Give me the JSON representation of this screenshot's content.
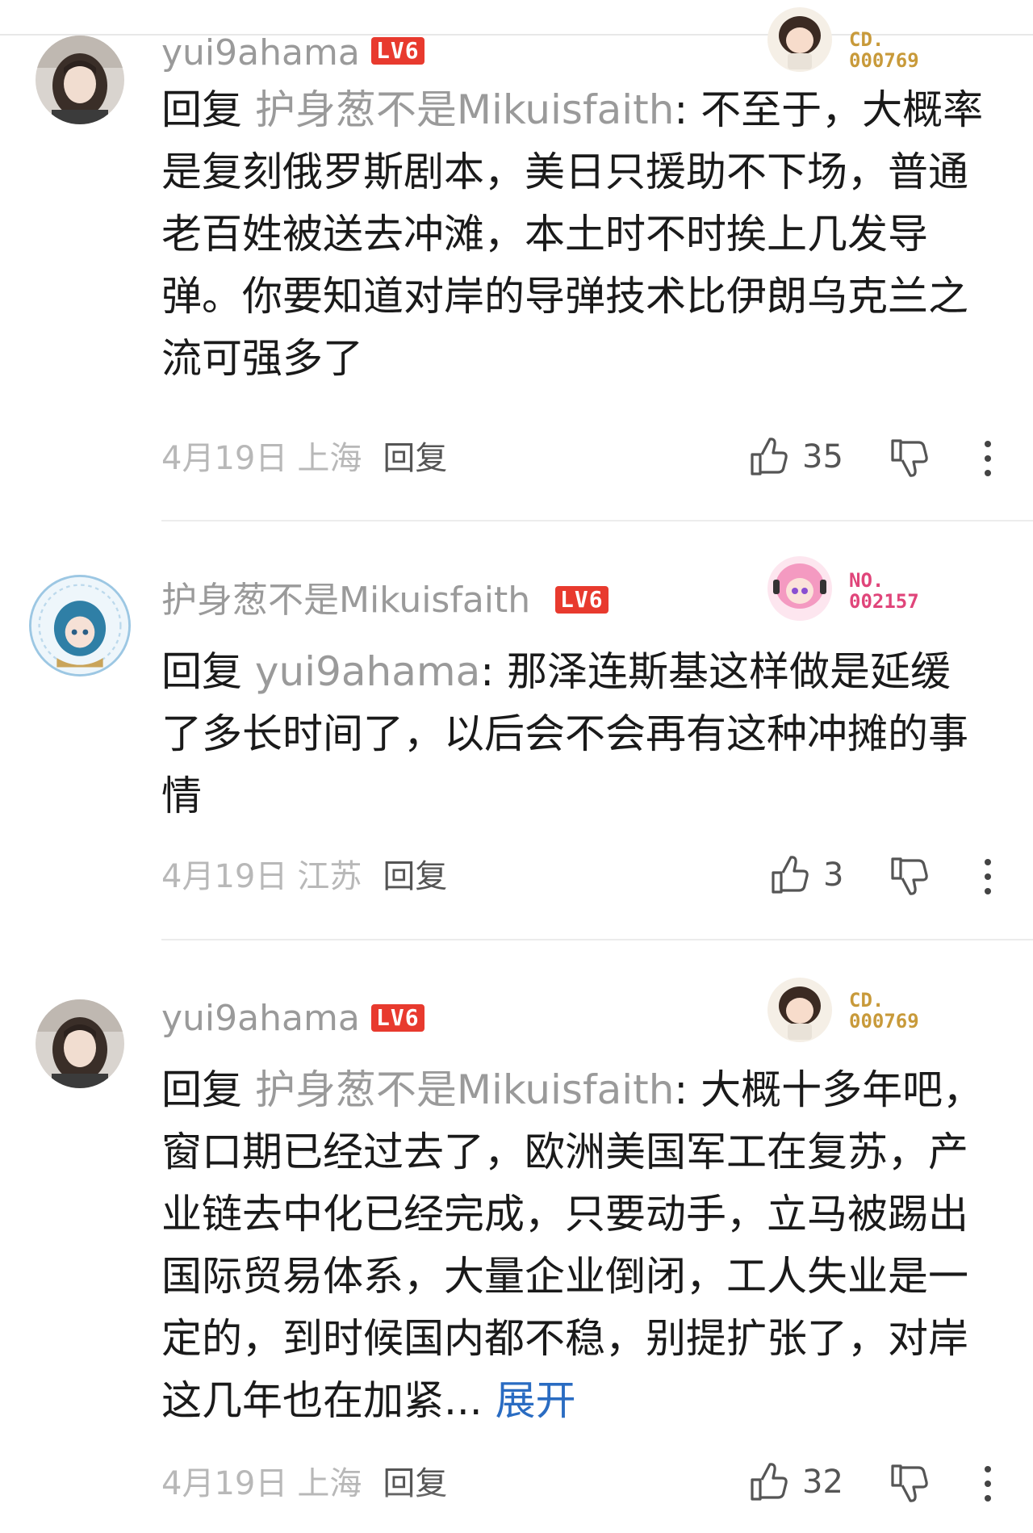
{
  "comments": [
    {
      "username": "yui9ahama",
      "level": "LV6",
      "badge_no": "CD.\n000769",
      "badge_color": "#c89a3a",
      "reply_prefix": "回复",
      "reply_target": "护身葱不是Mikuisfaith",
      "text": ": 不至于，大概率是复刻俄罗斯剧本，美日只援助不下场，普通老百姓被送去冲滩，本土时不时挨上几发导弹。你要知道对岸的导弹技术比伊朗乌克兰之流可强多了",
      "date": "4月19日",
      "location": "上海",
      "reply_label": "回复",
      "likes": "35",
      "avatar_icon": "girl-photo-avatar"
    },
    {
      "username": "护身葱不是Mikuisfaith",
      "level": "LV6",
      "badge_no": "NO.\n002157",
      "badge_color": "#e0457a",
      "reply_prefix": "回复",
      "reply_target": "yui9ahama",
      "text": ": 那泽连斯基这样做是延缓了多长时间了，以后会不会再有这种冲摊的事情",
      "date": "4月19日",
      "location": "江苏",
      "reply_label": "回复",
      "likes": "3",
      "avatar_icon": "anime-character-avatar"
    },
    {
      "username": "yui9ahama",
      "level": "LV6",
      "badge_no": "CD.\n000769",
      "badge_color": "#c89a3a",
      "reply_prefix": "回复",
      "reply_target": "护身葱不是Mikuisfaith",
      "text": ": 大概十多年吧，窗口期已经过去了，欧洲美国军工在复苏，产业链去中化已经完成，只要动手，立马被踢出国际贸易体系，大量企业倒闭，工人失业是一定的，到时候国内都不稳，别提扩张了，对岸这几年也在加紧...",
      "expand_label": "展开",
      "date": "4月19日",
      "location": "上海",
      "reply_label": "回复",
      "likes": "32",
      "avatar_icon": "girl-photo-avatar"
    }
  ],
  "colors": {
    "level_badge": "#e83a2e",
    "expand_link": "#2a6cc2",
    "muted_text": "#9a9a9a"
  }
}
